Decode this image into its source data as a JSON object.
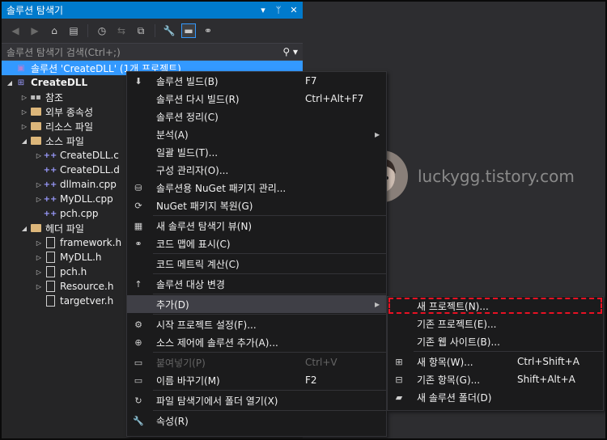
{
  "panel": {
    "title": "솔루션 탐색기",
    "search_placeholder": "솔루션 탐색기 검색(Ctrl+;)"
  },
  "tree": [
    {
      "label": "솔루션 'CreateDLL' (1개 프로젝트)",
      "icon": "solution-icon",
      "depth": 0,
      "arrow": "",
      "selected": true
    },
    {
      "label": "CreateDLL",
      "icon": "project-icon",
      "depth": 0,
      "arrow": "▲",
      "bold": true
    },
    {
      "label": "참조",
      "icon": "reference-icon",
      "depth": 1,
      "arrow": "▷"
    },
    {
      "label": "외부 종속성",
      "icon": "folder-icon",
      "depth": 1,
      "arrow": "▷"
    },
    {
      "label": "리소스 파일",
      "icon": "folder-icon",
      "depth": 1,
      "arrow": "▷"
    },
    {
      "label": "소스 파일",
      "icon": "folder-icon",
      "depth": 1,
      "arrow": "▲"
    },
    {
      "label": "CreateDLL.c",
      "icon": "cpp-icon",
      "depth": 2,
      "arrow": "▷"
    },
    {
      "label": "CreateDLL.d",
      "icon": "cpp-icon",
      "depth": 2,
      "arrow": ""
    },
    {
      "label": "dllmain.cpp",
      "icon": "cpp-icon",
      "depth": 2,
      "arrow": "▷"
    },
    {
      "label": "MyDLL.cpp",
      "icon": "cpp-icon",
      "depth": 2,
      "arrow": "▷"
    },
    {
      "label": "pch.cpp",
      "icon": "cpp-icon",
      "depth": 2,
      "arrow": ""
    },
    {
      "label": "헤더 파일",
      "icon": "folder-icon",
      "depth": 1,
      "arrow": "▲"
    },
    {
      "label": "framework.h",
      "icon": "header-icon",
      "depth": 2,
      "arrow": "▷"
    },
    {
      "label": "MyDLL.h",
      "icon": "header-icon",
      "depth": 2,
      "arrow": "▷"
    },
    {
      "label": "pch.h",
      "icon": "header-icon",
      "depth": 2,
      "arrow": "▷"
    },
    {
      "label": "Resource.h",
      "icon": "header-icon",
      "depth": 2,
      "arrow": "▷"
    },
    {
      "label": "targetver.h",
      "icon": "header-icon",
      "depth": 2,
      "arrow": ""
    }
  ],
  "menu": [
    {
      "label": "솔루션 빌드(B)",
      "key": "F7",
      "icon": "build-icon"
    },
    {
      "label": "솔루션 다시 빌드(R)",
      "key": "Ctrl+Alt+F7"
    },
    {
      "label": "솔루션 정리(C)",
      "key": ""
    },
    {
      "label": "분석(A)",
      "key": "",
      "sub": true
    },
    {
      "label": "일괄 빌드(T)...",
      "key": ""
    },
    {
      "label": "구성 관리자(O)...",
      "key": ""
    },
    {
      "label": "솔루션용 NuGet 패키지 관리...",
      "key": "",
      "icon": "nuget-icon"
    },
    {
      "label": "NuGet 패키지 복원(G)",
      "key": "",
      "icon": "nuget-restore-icon",
      "sep_after": true
    },
    {
      "label": "새 솔루션 탐색기 뷰(N)",
      "key": "",
      "icon": "new-view-icon"
    },
    {
      "label": "코드 맵에 표시(C)",
      "key": "",
      "icon": "code-map-icon",
      "sep_after": true
    },
    {
      "label": "코드 메트릭 계산(C)",
      "key": "",
      "sep_after": true
    },
    {
      "label": "솔루션 대상 변경",
      "key": "",
      "icon": "arrow-up-icon",
      "sep_after": true
    },
    {
      "label": "추가(D)",
      "key": "",
      "sub": true,
      "highlight": true,
      "sep_after": true
    },
    {
      "label": "시작 프로젝트 설정(F)...",
      "key": "",
      "icon": "gear-icon"
    },
    {
      "label": "소스 제어에 솔루션 추가(A)...",
      "key": "",
      "icon": "source-control-icon",
      "sep_after": true
    },
    {
      "label": "붙여넣기(P)",
      "key": "Ctrl+V",
      "disabled": true,
      "icon": "paste-icon"
    },
    {
      "label": "이름 바꾸기(M)",
      "key": "F2",
      "icon": "rename-icon",
      "sep_after": true
    },
    {
      "label": "파일 탐색기에서 폴더 열기(X)",
      "key": "",
      "icon": "refresh-icon",
      "sep_after": true
    },
    {
      "label": "속성(R)",
      "key": "",
      "icon": "wrench-icon"
    }
  ],
  "submenu": [
    {
      "label": "새 프로젝트(N)...",
      "key": "",
      "boxed": true
    },
    {
      "label": "기존 프로젝트(E)...",
      "key": ""
    },
    {
      "label": "기존 웹 사이트(B)...",
      "key": "",
      "sep_after": true
    },
    {
      "label": "새 항목(W)...",
      "key": "Ctrl+Shift+A",
      "icon": "new-item-icon"
    },
    {
      "label": "기존 항목(G)...",
      "key": "Shift+Alt+A",
      "icon": "existing-item-icon"
    },
    {
      "label": "새 솔루션 폴더(D)",
      "key": "",
      "icon": "new-folder-icon"
    }
  ],
  "watermark": "luckygg.tistory.com",
  "colors": {
    "accent": "#007acc",
    "selection": "#3399ff",
    "highlight_box": "#e81123"
  }
}
